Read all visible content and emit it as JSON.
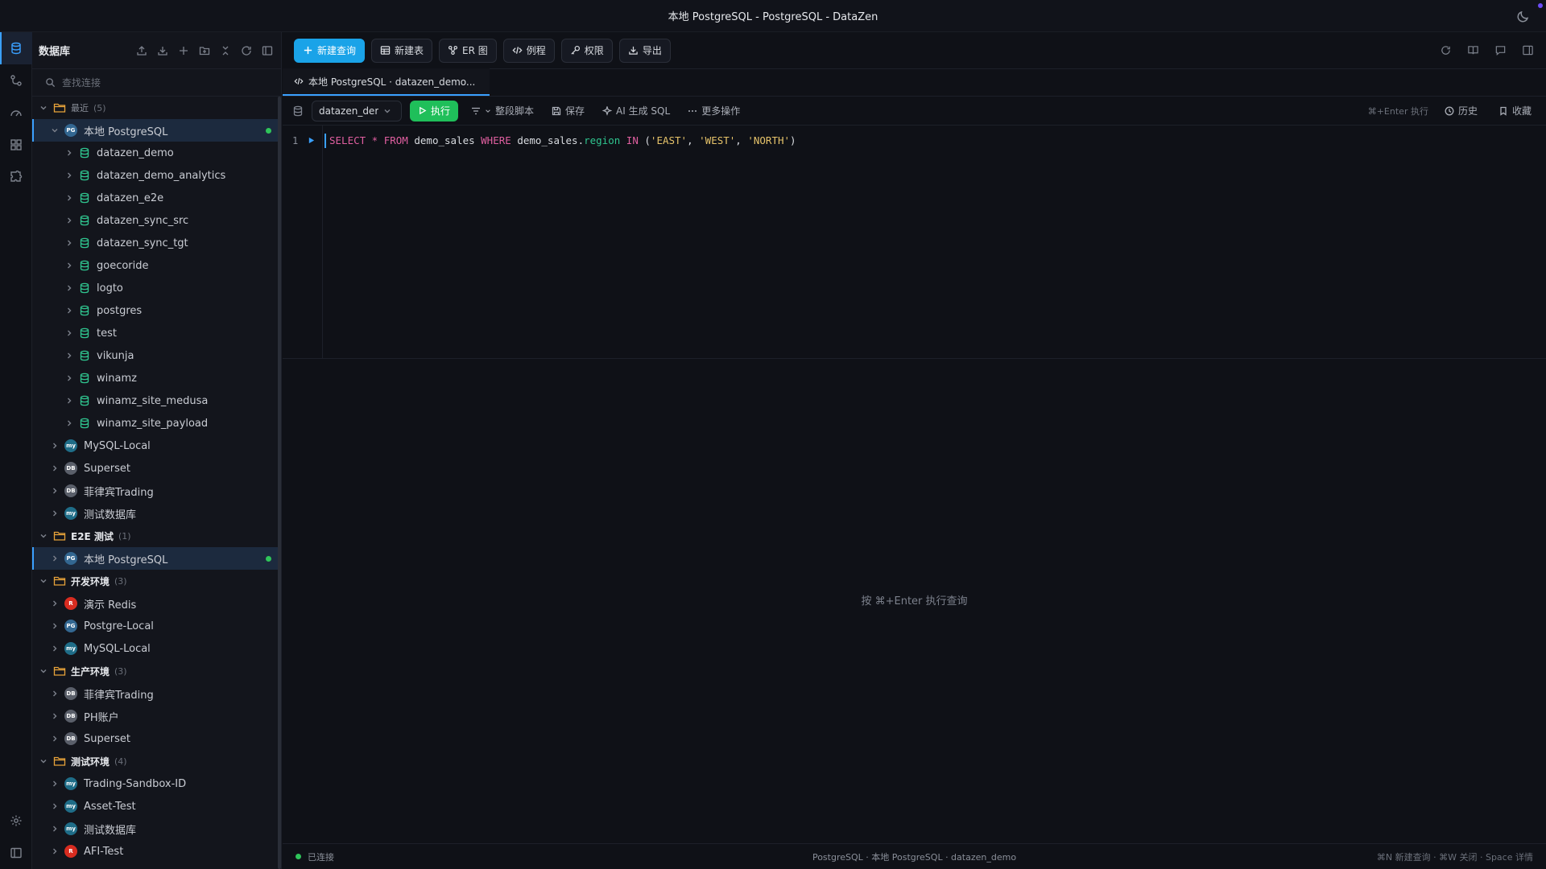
{
  "window": {
    "title": "本地 PostgreSQL - PostgreSQL - DataZen"
  },
  "sidebar": {
    "title": "数据库",
    "search_placeholder": "查找连接",
    "groups": [
      {
        "name": "最近",
        "count": "(5)",
        "items": [
          {
            "name": "本地 PostgreSQL",
            "type": "pg",
            "connected": true,
            "expanded": true,
            "databases": [
              "datazen_demo",
              "datazen_demo_analytics",
              "datazen_e2e",
              "datazen_sync_src",
              "datazen_sync_tgt",
              "goecoride",
              "logto",
              "postgres",
              "test",
              "vikunja",
              "winamz",
              "winamz_site_medusa",
              "winamz_site_payload"
            ]
          },
          {
            "name": "MySQL-Local",
            "type": "mysql"
          },
          {
            "name": "Superset",
            "type": "db"
          },
          {
            "name": "菲律宾Trading",
            "type": "db"
          },
          {
            "name": "测试数据库",
            "type": "mysql"
          }
        ]
      },
      {
        "name": "E2E 测试",
        "count": "(1)",
        "items": [
          {
            "name": "本地 PostgreSQL",
            "type": "pg",
            "connected": true
          }
        ]
      },
      {
        "name": "开发环境",
        "count": "(3)",
        "items": [
          {
            "name": "演示 Redis",
            "type": "redis"
          },
          {
            "name": "Postgre-Local",
            "type": "pg"
          },
          {
            "name": "MySQL-Local",
            "type": "mysql"
          }
        ]
      },
      {
        "name": "生产环境",
        "count": "(3)",
        "items": [
          {
            "name": "菲律宾Trading",
            "type": "db"
          },
          {
            "name": "PH账户",
            "type": "db"
          },
          {
            "name": "Superset",
            "type": "db"
          }
        ]
      },
      {
        "name": "测试环境",
        "count": "(4)",
        "items": [
          {
            "name": "Trading-Sandbox-ID",
            "type": "mysql"
          },
          {
            "name": "Asset-Test",
            "type": "mysql"
          },
          {
            "name": "测试数据库",
            "type": "mysql"
          },
          {
            "name": "AFI-Test",
            "type": "redis"
          }
        ]
      }
    ]
  },
  "toolbar": {
    "new_query": "新建查询",
    "new_table": "新建表",
    "er": "ER 图",
    "routines": "例程",
    "permissions": "权限",
    "export": "导出"
  },
  "tab": {
    "label": "本地 PostgreSQL · datazen_demo..."
  },
  "editor": {
    "database": "datazen_demo",
    "run": "执行",
    "format": "整段脚本",
    "save": "保存",
    "ai": "AI 生成 SQL",
    "more": "更多操作",
    "run_hint": "⌘+Enter 执行",
    "history": "历史",
    "favorites": "收藏",
    "line_number": "1",
    "sql": {
      "k_select": "SELECT",
      "star": " * ",
      "k_from": "FROM",
      "table": " demo_sales ",
      "k_where": "WHERE",
      "qual": " demo_sales.",
      "field": "region",
      "sp": " ",
      "k_in": "IN",
      "open": " (",
      "s1": "'EAST'",
      "c1": ", ",
      "s2": "'WEST'",
      "c2": ", ",
      "s3": "'NORTH'",
      "close": ")"
    }
  },
  "results": {
    "placeholder": "按 ⌘+Enter 执行查询"
  },
  "status": {
    "connected": "已连接",
    "context": "PostgreSQL · 本地 PostgreSQL · datazen_demo",
    "shortcuts": "⌘N 新建查询 · ⌘W 关闭 · Space 详情"
  },
  "colors": {
    "accent": "#1aa3e8",
    "run": "#1fbf5a",
    "connected": "#2fc55a"
  }
}
